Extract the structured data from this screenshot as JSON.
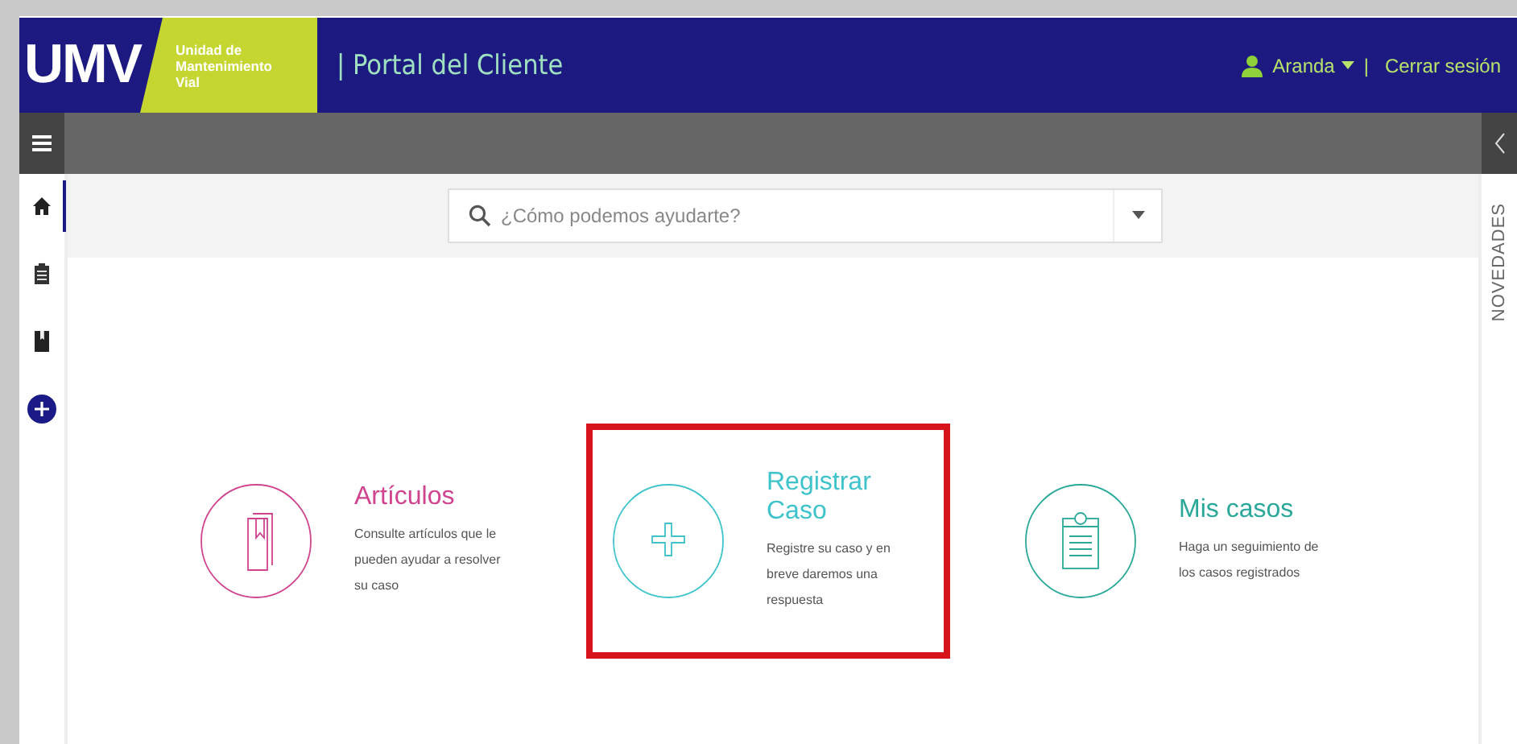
{
  "header": {
    "logo": "UMV",
    "logo_subtitle": [
      "Unidad de",
      "Mantenimiento",
      "Vial"
    ],
    "title": "| Portal del Cliente",
    "user": "Aranda",
    "separator": "|",
    "logout": "Cerrar sesión"
  },
  "sidebar": {
    "items": [
      {
        "kind": "home",
        "selected": true
      },
      {
        "kind": "clipboard",
        "selected": false
      },
      {
        "kind": "book",
        "selected": false
      },
      {
        "kind": "add",
        "selected": false
      }
    ]
  },
  "search": {
    "placeholder": "¿Cómo podemos ayudarte?"
  },
  "cards": [
    {
      "kind": "book",
      "title": "Artículos",
      "description": "Consulte artículos que le pueden ayudar a resolver su caso",
      "color": "#d0448f",
      "highlighted": false
    },
    {
      "kind": "add",
      "title": "Registrar Caso",
      "description": "Registre su caso y en breve daremos una respuesta",
      "color": "#3fc3cb",
      "highlighted": true
    },
    {
      "kind": "clipboard",
      "title": "Mis casos",
      "description": "Haga un seguimiento de los casos registrados",
      "color": "#2aa899",
      "highlighted": false
    }
  ],
  "news_panel": {
    "label": "NOVEDADES"
  }
}
